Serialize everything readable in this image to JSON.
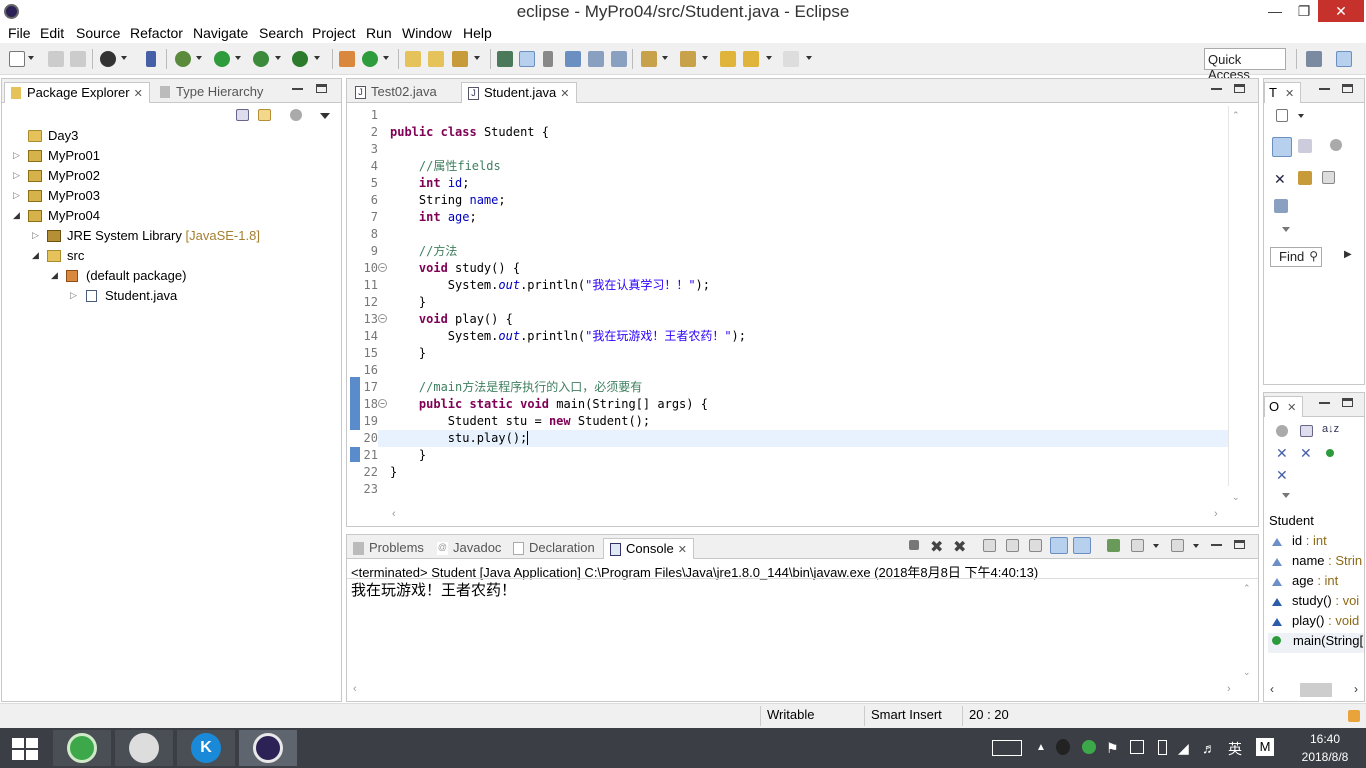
{
  "window": {
    "title": "eclipse - MyPro04/src/Student.java - Eclipse"
  },
  "menu": [
    "File",
    "Edit",
    "Source",
    "Refactor",
    "Navigate",
    "Search",
    "Project",
    "Run",
    "Window",
    "Help"
  ],
  "toolbar": {
    "quick_access": "Quick Access"
  },
  "package_explorer": {
    "tab_label": "Package Explorer",
    "tab2_label": "Type Hierarchy",
    "tree": [
      {
        "label": "Day3",
        "decoration": ""
      },
      {
        "label": "MyPro01",
        "decoration": ""
      },
      {
        "label": "MyPro02",
        "decoration": ""
      },
      {
        "label": "MyPro03",
        "decoration": ""
      },
      {
        "label": "MyPro04",
        "decoration": ""
      },
      {
        "label": "JRE System Library",
        "decoration": "[JavaSE-1.8]"
      },
      {
        "label": "src",
        "decoration": ""
      },
      {
        "label": "(default package)",
        "decoration": ""
      },
      {
        "label": "Student.java",
        "decoration": ""
      }
    ]
  },
  "editor": {
    "tabs": [
      "Test02.java",
      "Student.java"
    ],
    "active_tab": "Student.java",
    "line_numbers": [
      "1",
      "2",
      "3",
      "4",
      "5",
      "6",
      "7",
      "8",
      "9",
      "10",
      "11",
      "12",
      "13",
      "14",
      "15",
      "16",
      "17",
      "18",
      "19",
      "20",
      "21",
      "22",
      "23"
    ]
  },
  "console": {
    "tabs": [
      "Problems",
      "Javadoc",
      "Declaration",
      "Console"
    ],
    "active_tab": "Console",
    "status_line": "<terminated> Student [Java Application] C:\\Program Files\\Java\\jre1.8.0_144\\bin\\javaw.exe (2018年8月8日 下午4:40:13)",
    "output": "我在玩游戏！王者农药！"
  },
  "right_top_panel": {
    "tab_label": "T",
    "find_placeholder": "Find"
  },
  "outline": {
    "tab_label": "O",
    "class_name": "Student",
    "items": [
      {
        "name": "id",
        "type": " : int"
      },
      {
        "name": "name",
        "type": " : Strin"
      },
      {
        "name": "age",
        "type": " : int"
      },
      {
        "name": "study()",
        "type": " : voi"
      },
      {
        "name": "play()",
        "type": " : void"
      },
      {
        "name": "main(String[",
        "type": ""
      }
    ]
  },
  "statusbar": {
    "writable": "Writable",
    "insert_mode": "Smart Insert",
    "position": "20 : 20"
  },
  "taskbar": {
    "time": "16:40",
    "date": "2018/8/8",
    "ime": "英"
  }
}
